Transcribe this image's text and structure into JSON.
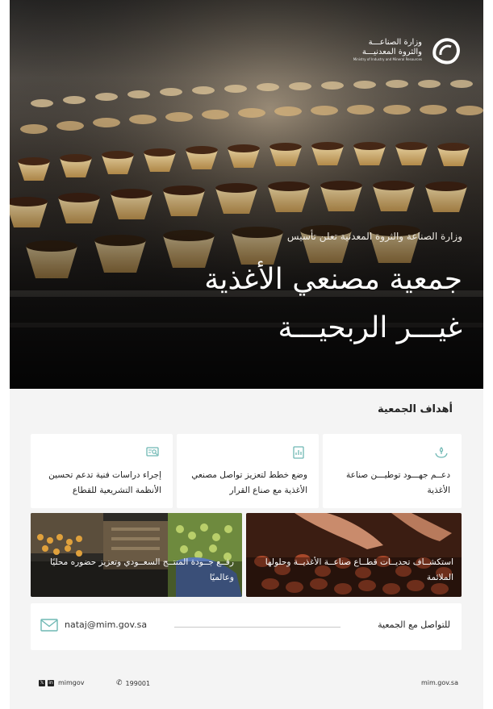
{
  "hero": {
    "logo": {
      "name_ar_line1": "وزارة الصناعـــة",
      "name_ar_line2": "والثروة المعدنيـــة",
      "name_en": "Ministry of Industry and Mineral Resources"
    },
    "announcement": "وزارة الصناعة والثروة المعدنية تعلن تأسيس",
    "title_line1": "جمعية مصنعي الأغذية",
    "title_line2": "غيـــر الربحيـــة"
  },
  "goals": {
    "title": "أهداف الجمعية",
    "cards": [
      {
        "icon": "hands-plant-icon",
        "text": "دعــم جهـــود توطيـــن صناعة الأغذية"
      },
      {
        "icon": "document-chart-icon",
        "text": "وضع خطط لتعزيز تواصل مصنعي الأغذية مع صناع القرار"
      },
      {
        "icon": "research-icon",
        "text": "إجراء دراسات فنية تدعم تحسين الأنظمة التشريعية للقطاع"
      }
    ],
    "photos": [
      {
        "text": "استكشــاف تحديــات قطــاع صناعــة الأغذيــة وحلولها الملائمة"
      },
      {
        "text": "رفــع جــودة المنتــج السعــودي وتعزيز حضوره محليًا وعالميًا"
      }
    ]
  },
  "contact": {
    "label": "للتواصل مع الجمعية",
    "email": "nataj@mim.gov.sa"
  },
  "footer": {
    "social_handle": "mimgov",
    "phone": "199001",
    "website": "mim.gov.sa"
  },
  "colors": {
    "accent_teal": "#6fb8b4",
    "card_bg": "#ffffff",
    "page_bg": "#f4f4f4"
  }
}
